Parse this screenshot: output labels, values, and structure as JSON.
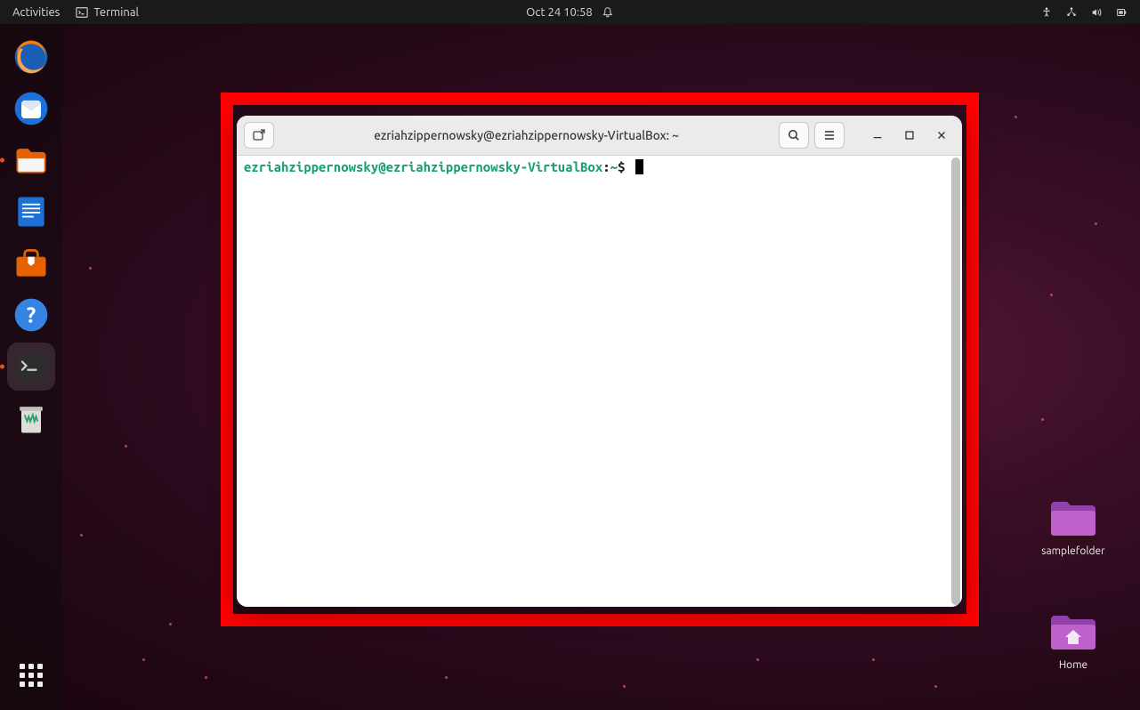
{
  "topbar": {
    "activities": "Activities",
    "app_name": "Terminal",
    "datetime": "Oct 24  10:58"
  },
  "dock": {
    "items": [
      {
        "name": "firefox",
        "running": false
      },
      {
        "name": "thunderbird",
        "running": false
      },
      {
        "name": "files",
        "running": true
      },
      {
        "name": "libreoffice-writer",
        "running": false
      },
      {
        "name": "ubuntu-software",
        "running": false
      },
      {
        "name": "help",
        "running": false
      },
      {
        "name": "terminal",
        "running": true,
        "active": true
      },
      {
        "name": "trash",
        "running": false
      }
    ]
  },
  "desktop_icons": [
    {
      "label": "samplefolder",
      "type": "folder"
    },
    {
      "label": "Home",
      "type": "home"
    }
  ],
  "terminal": {
    "title": "ezriahzippernowsky@ezriahzippernowsky-VirtualBox: ~",
    "prompt_user_host": "ezriahzippernowsky@ezriahzippernowsky-VirtualBox",
    "prompt_sep": ":",
    "prompt_path": "~",
    "prompt_symbol": "$"
  }
}
